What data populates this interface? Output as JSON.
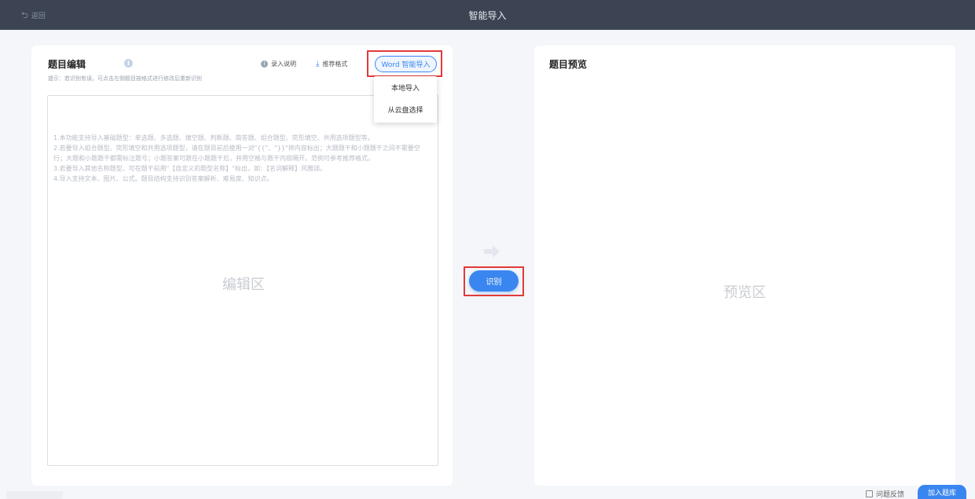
{
  "header": {
    "back_label": "返回",
    "title": "智能导入"
  },
  "editor_panel": {
    "title": "题目编辑",
    "tip": "提示：若识别有误，可点击左侧题目按格式进行修改后重新识别",
    "import_desc_label": "录入说明",
    "recommended_format_label": "推荐格式",
    "word_import_label": "Word 智能导入",
    "dropdown": [
      "本地导入",
      "从云盘选择"
    ],
    "instructions": [
      "1.本功能支持导入基础题型：单选题、多选题、填空题、判断题、简答题、组合题型、完形填空、共用选项题型等。",
      "2.若要导入组合题型、完形填空和共用选项题型，请在题目前后使用一对\"{{\"、\"}}\"将内容标出；大题题干和小题题干之间不需要空行；大题和小题题干都需标注题号；小题答案可跟在小题题干后，并用空格与题干内容隔开。范例可参考推荐格式。",
      "3.若要导入其他名称题型，可在题干前用\"【自定义的题型名称】\"标出，如：【名词解释】风雅颂。",
      "4.导入支持文本、图片、公式。题目结构支持识别答案解析、难易度、知识点。"
    ],
    "placeholder": "编辑区"
  },
  "middle": {
    "recognize_label": "识别"
  },
  "preview_panel": {
    "title": "题目预览",
    "placeholder": "预览区"
  },
  "footer": {
    "feedback_label": "问题反馈",
    "add_to_bank_label": "加入题库"
  },
  "colors": {
    "header_bg": "#3c4454",
    "accent": "#3a86f0",
    "highlight_box": "#e23a3a"
  }
}
